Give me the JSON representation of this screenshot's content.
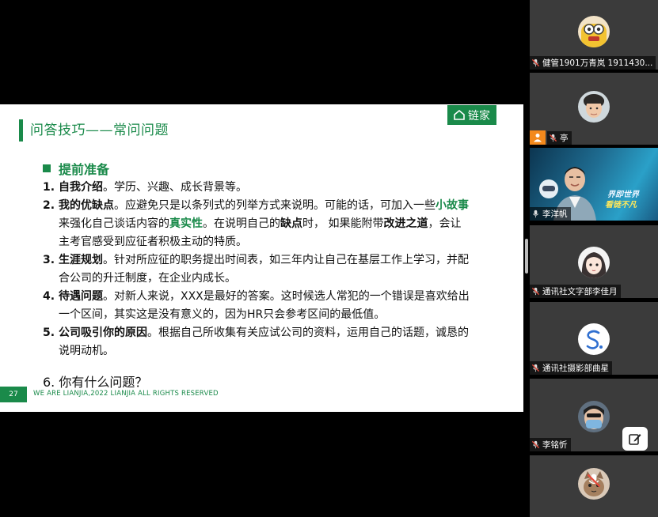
{
  "slide": {
    "title": "问答技巧——常问问题",
    "logo_text": "链家",
    "section_heading": "提前准备",
    "items": [
      {
        "num": "1.",
        "parts": [
          {
            "t": "自我介绍",
            "s": "b"
          },
          {
            "t": "。学历、兴趣、成长背景等。",
            "s": ""
          }
        ]
      },
      {
        "num": "2.",
        "parts": [
          {
            "t": "我的优缺点",
            "s": "b"
          },
          {
            "t": "。应避免只是以条列式的列举方式来说明。可能的话，可加入一些",
            "s": ""
          },
          {
            "t": "小故事",
            "s": "g"
          },
          {
            "t": "来强化自己谈话内容的",
            "s": ""
          },
          {
            "t": "真实性",
            "s": "g"
          },
          {
            "t": "。在说明自己的",
            "s": ""
          },
          {
            "t": "缺点",
            "s": "b"
          },
          {
            "t": "时， 如果能附带",
            "s": ""
          },
          {
            "t": "改进之道",
            "s": "b"
          },
          {
            "t": "，会让主考官感受到应征者积极主动的特质。",
            "s": ""
          }
        ]
      },
      {
        "num": "3.",
        "parts": [
          {
            "t": "生涯规划",
            "s": "b"
          },
          {
            "t": "。针对所应征的职务提出时间表，如三年内让自己在基层工作上学习，并配合公司的升迁制度，在企业内成长。",
            "s": ""
          }
        ]
      },
      {
        "num": "4.",
        "parts": [
          {
            "t": "待遇问题",
            "s": "b"
          },
          {
            "t": "。对新人来说，XXX是最好的答案。这时候选人常犯的一个错误是喜欢给出一个区间，其实这是没有意义的，因为HR只会参考区间的最低值。",
            "s": ""
          }
        ]
      },
      {
        "num": "5.",
        "parts": [
          {
            "t": "公司吸引你的原因",
            "s": "b"
          },
          {
            "t": "。根据自己所收集有关应试公司的资料，运用自己的话题，诚恳的说明动机。",
            "s": ""
          }
        ]
      }
    ],
    "question6": "6. 你有什么问题？",
    "page_number": "27",
    "footer": "WE ARE LIANJIA,2022 LIANJIA ALL RIGHTS RESERVED"
  },
  "participants": [
    {
      "name": "健管1901万青岚 1911430...",
      "type": "avatar",
      "icon": "cartoon-avatar"
    },
    {
      "name": "亭",
      "type": "avatar",
      "icon": "man-avatar",
      "host_badge": true
    },
    {
      "name": "李洋帆",
      "type": "video",
      "active": true,
      "video_text": [
        "界即世界",
        "看链不凡"
      ]
    },
    {
      "name": "通讯社文字部李佳月",
      "type": "avatar",
      "icon": "anime-girl-avatar"
    },
    {
      "name": "通讯社摄影部曲星",
      "type": "avatar",
      "icon": "letter-s-avatar"
    },
    {
      "name": "李铭忻",
      "type": "avatar",
      "icon": "masked-avatar"
    },
    {
      "name": "",
      "type": "avatar",
      "icon": "cat-avatar"
    }
  ],
  "colors": {
    "brand_green": "#1a8a4a",
    "active_border": "#27c25a",
    "host_orange": "#f3891c"
  }
}
